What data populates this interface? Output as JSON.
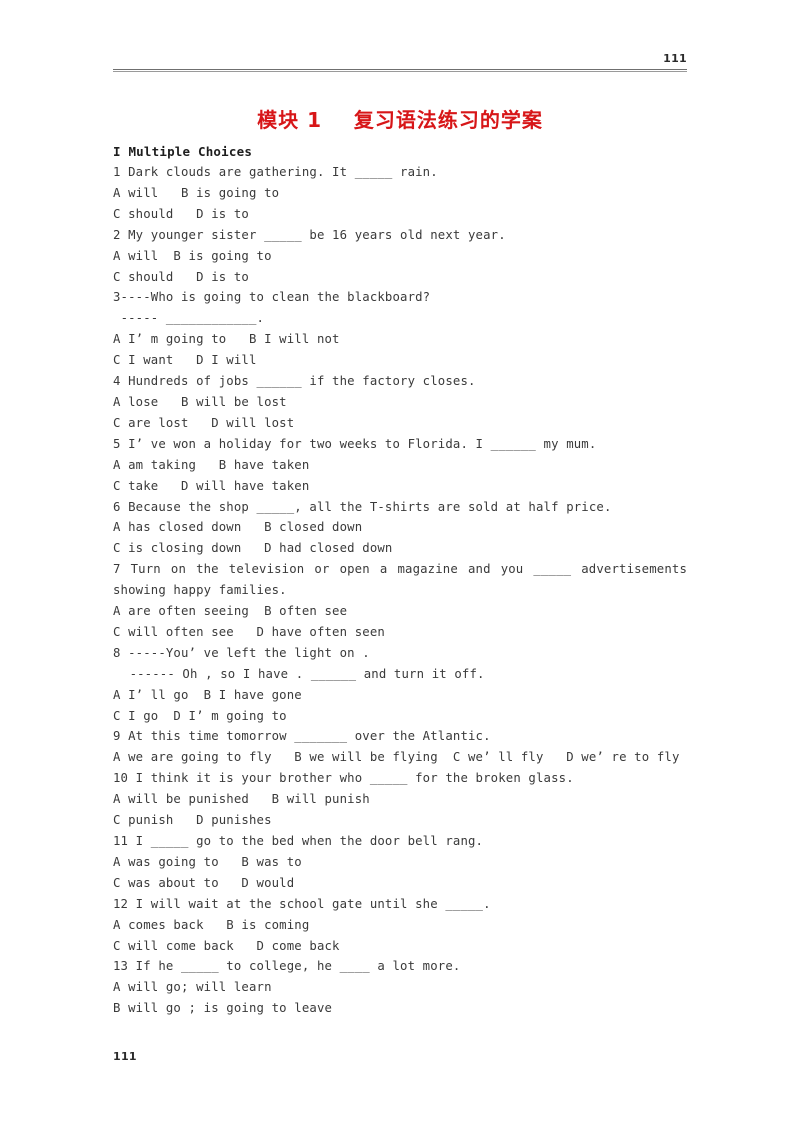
{
  "header": {
    "page_number": "111"
  },
  "title": "模块 1    复习语法练习的学案",
  "section_heading": "I Multiple Choices",
  "footer": {
    "page_number": "111"
  },
  "lines": [
    {
      "text": "1 Dark clouds are gathering. It _____ rain.",
      "style": "normal"
    },
    {
      "text": "A will   B is going to",
      "style": "normal"
    },
    {
      "text": "C should   D is to",
      "style": "normal"
    },
    {
      "text": "2 My younger sister _____ be 16 years old next year.",
      "style": "normal"
    },
    {
      "text": "A will  B is going to",
      "style": "normal"
    },
    {
      "text": "C should   D is to",
      "style": "normal"
    },
    {
      "text": "3----Who is going to clean the blackboard?",
      "style": "normal"
    },
    {
      "text": " ----- ____________.",
      "style": "normal"
    },
    {
      "text": "A I’ m going to   B I will not",
      "style": "normal"
    },
    {
      "text": "C I want   D I will",
      "style": "normal"
    },
    {
      "text": "4 Hundreds of jobs ______ if the factory closes.",
      "style": "normal"
    },
    {
      "text": "A lose   B will be lost",
      "style": "normal"
    },
    {
      "text": "C are lost   D will lost",
      "style": "normal"
    },
    {
      "text": "5 I’ ve won a holiday for two weeks to Florida. I ______ my mum.",
      "style": "normal"
    },
    {
      "text": "A am taking   B have taken",
      "style": "normal"
    },
    {
      "text": "C take   D will have taken",
      "style": "normal"
    },
    {
      "text": "6 Because the shop _____, all the T-shirts are sold at half price.",
      "style": "normal"
    },
    {
      "text": "A has closed down   B closed down",
      "style": "normal"
    },
    {
      "text": "C is closing down   D had closed down",
      "style": "normal"
    },
    {
      "text": "7 Turn on the television or open a magazine and you _____ advertisements",
      "style": "justify"
    },
    {
      "text": "showing happy families.",
      "style": "normal"
    },
    {
      "text": "A are often seeing  B often see",
      "style": "normal"
    },
    {
      "text": "C will often see   D have often seen",
      "style": "normal"
    },
    {
      "text": "8 -----You’ ve left the light on .",
      "style": "normal"
    },
    {
      "text": " ------ Oh , so I have . ______ and turn it off.",
      "style": "indent"
    },
    {
      "text": "A I’ ll go  B I have gone",
      "style": "normal"
    },
    {
      "text": "C I go  D I’ m going to",
      "style": "normal"
    },
    {
      "text": "9 At this time tomorrow _______ over the Atlantic.",
      "style": "normal"
    },
    {
      "text": "A we are going to fly   B we will be flying  C we’ ll fly   D we’ re to fly",
      "style": "normal"
    },
    {
      "text": "10 I think it is your brother who _____ for the broken glass.",
      "style": "normal"
    },
    {
      "text": "A will be punished   B will punish",
      "style": "normal"
    },
    {
      "text": "C punish   D punishes",
      "style": "normal"
    },
    {
      "text": "11 I _____ go to the bed when the door bell rang.",
      "style": "normal"
    },
    {
      "text": "A was going to   B was to",
      "style": "normal"
    },
    {
      "text": "C was about to   D would",
      "style": "normal"
    },
    {
      "text": "12 I will wait at the school gate until she _____.",
      "style": "normal"
    },
    {
      "text": "A comes back   B is coming",
      "style": "normal"
    },
    {
      "text": "C will come back   D come back",
      "style": "normal"
    },
    {
      "text": "13 If he _____ to college, he ____ a lot more.",
      "style": "normal"
    },
    {
      "text": "A will go; will learn",
      "style": "normal"
    },
    {
      "text": "B will go ; is going to leave",
      "style": "normal"
    }
  ]
}
